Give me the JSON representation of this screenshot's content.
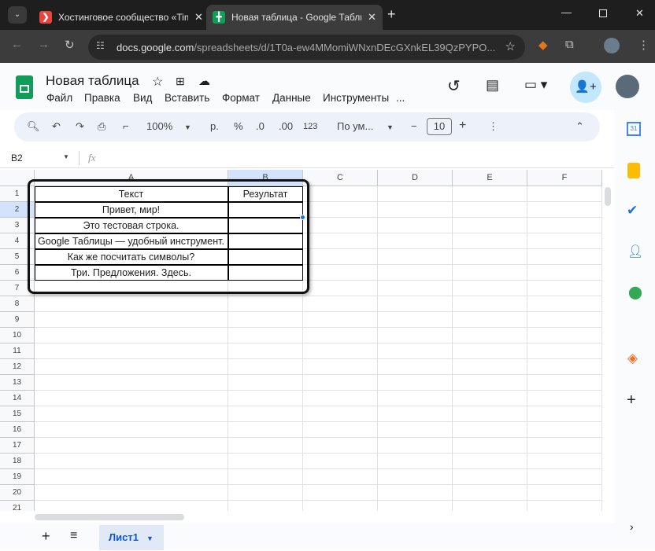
{
  "browser": {
    "tabs": [
      {
        "title": "Хостинговое сообщество «Timeweb»",
        "active": false
      },
      {
        "title": "Новая таблица - Google Таблицы",
        "active": true
      }
    ],
    "url_host": "docs.google.com",
    "url_path": "/spreadsheets/d/1T0a-ew4MMomiWNxnDEcGXnkEL39QzPYPO..."
  },
  "doc": {
    "title": "Новая таблица",
    "menu": [
      "Файл",
      "Правка",
      "Вид",
      "Вставить",
      "Формат",
      "Данные",
      "Инструменты",
      "..."
    ]
  },
  "toolbar": {
    "zoom": "100%",
    "currency": "р.",
    "percent": "%",
    "dec_less": ".0",
    "dec_more": ".00",
    "format": "123",
    "font": "По ум...",
    "font_size": "10"
  },
  "formula": {
    "cell_ref": "B2",
    "fx": "fx"
  },
  "columns": [
    "A",
    "B",
    "C",
    "D",
    "E",
    "F"
  ],
  "rows": [
    "1",
    "2",
    "3",
    "4",
    "5",
    "6",
    "7",
    "8",
    "9",
    "10",
    "11",
    "12",
    "13",
    "14",
    "15",
    "16",
    "17",
    "18",
    "19",
    "20",
    "21"
  ],
  "cells": {
    "A": [
      "Текст",
      "Привет, мир!",
      "Это тестовая строка.",
      "Google Таблицы — удобный инструмент.",
      "Как же посчитать символы?",
      "Три. Предложения. Здесь."
    ],
    "B1": "Результат"
  },
  "sheets": [
    {
      "name": "Лист1"
    }
  ]
}
